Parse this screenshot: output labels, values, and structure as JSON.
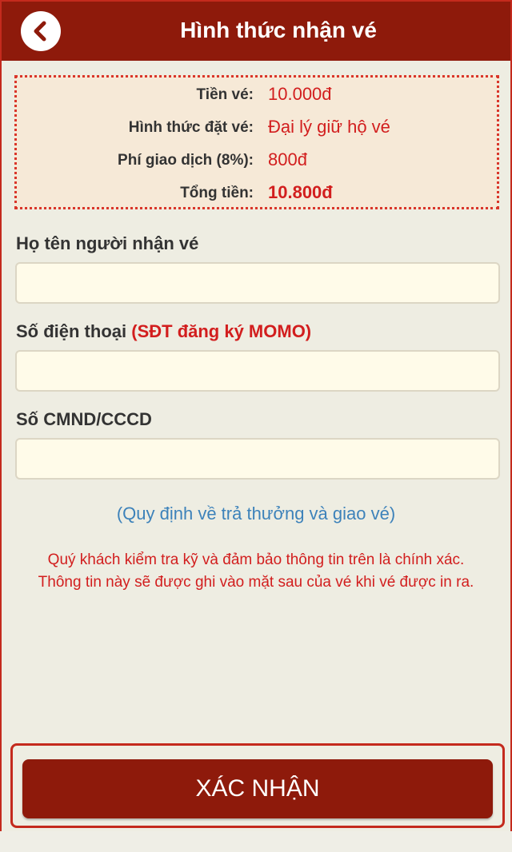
{
  "header": {
    "title": "Hình thức nhận vé"
  },
  "summary": {
    "rows": [
      {
        "label": "Tiền vé:",
        "value": "10.000đ"
      },
      {
        "label": "Hình thức đặt vé:",
        "value": "Đại lý giữ hộ vé"
      },
      {
        "label": "Phí giao dịch (8%):",
        "value": "800đ"
      },
      {
        "label": "Tổng tiền:",
        "value": "10.800đ"
      }
    ]
  },
  "form": {
    "name_label": "Họ tên người nhận vé",
    "name_value": "",
    "phone_label": "Số điện thoại",
    "phone_note": "(SĐT đăng ký MOMO)",
    "phone_value": "",
    "id_label": "Số CMND/CCCD",
    "id_value": ""
  },
  "rules_link": "(Quy định về trả thưởng và giao vé)",
  "notice": {
    "line1": "Quý khách kiểm tra kỹ và đảm bảo thông tin trên là chính xác.",
    "line2": "Thông tin này sẽ được ghi vào mặt sau của vé khi vé được in ra."
  },
  "confirm_button": "XÁC NHẬN",
  "colors": {
    "brand": "#8e1a0b",
    "accent_red": "#d21e1e",
    "link_blue": "#3d82ba"
  }
}
